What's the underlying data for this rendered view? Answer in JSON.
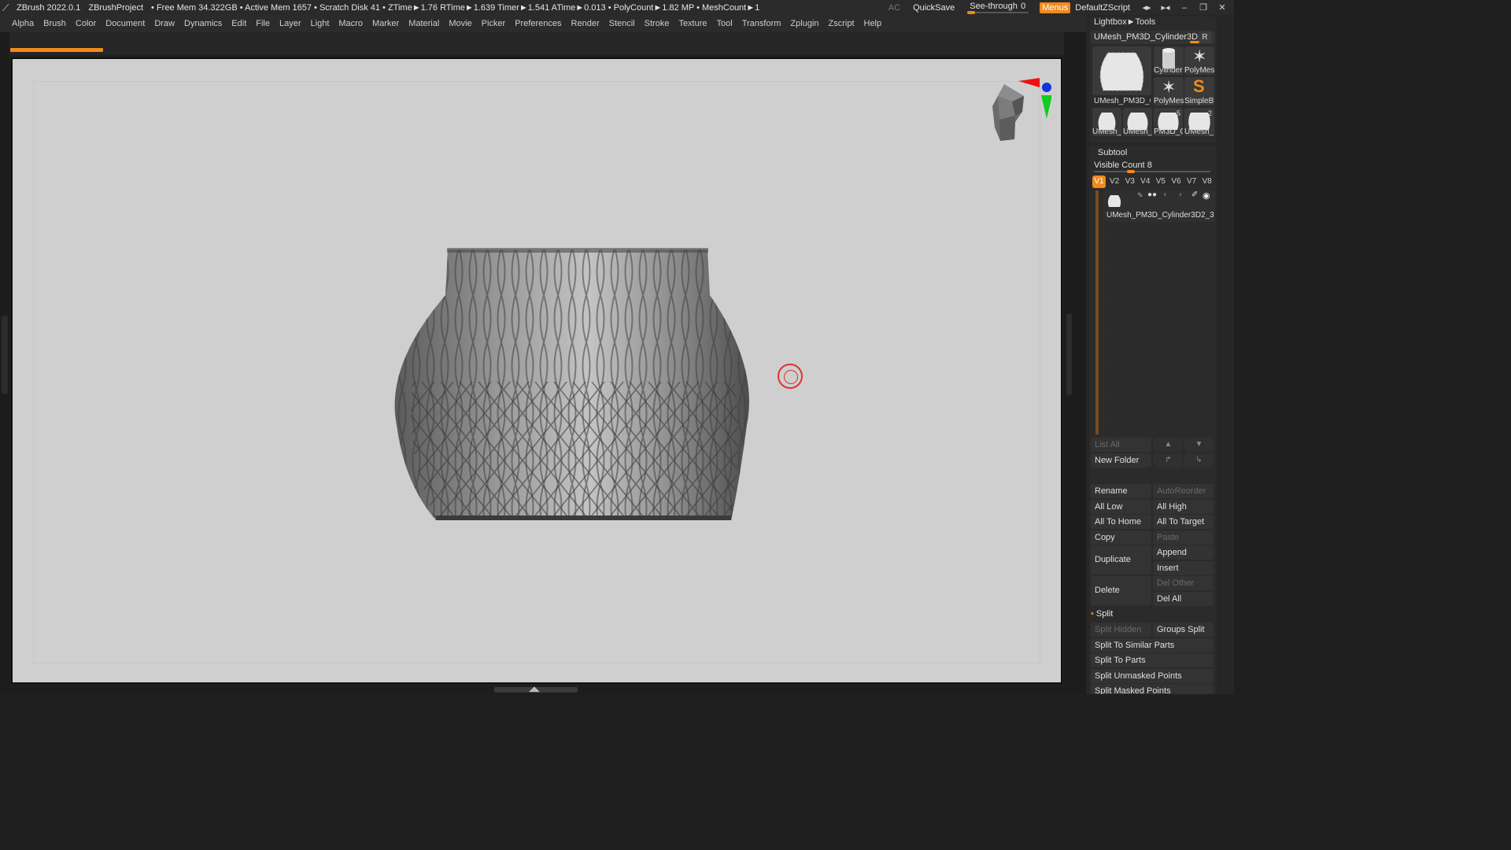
{
  "titlebar": {
    "app": "ZBrush 2022.0.1",
    "project": "ZBrushProject",
    "stats": "• Free Mem 34.322GB • Active Mem 1657 • Scratch Disk 41 • ZTime►1.76 RTime►1.639 Timer►1.541 ATime►0.013 • PolyCount►1.82 MP • MeshCount►1",
    "ac": "AC",
    "quicksave": "QuickSave",
    "see_through_label": "See-through",
    "see_through_value": "0",
    "menus": "Menus",
    "default_zscript": "DefaultZScript",
    "accent": "#f08a1c"
  },
  "menu": [
    "Alpha",
    "Brush",
    "Color",
    "Document",
    "Draw",
    "Dynamics",
    "Edit",
    "File",
    "Layer",
    "Light",
    "Macro",
    "Marker",
    "Material",
    "Movie",
    "Picker",
    "Preferences",
    "Render",
    "Stencil",
    "Stroke",
    "Texture",
    "Tool",
    "Transform",
    "Zplugin",
    "Zscript",
    "Help"
  ],
  "tool_palette": {
    "breadcrumb": "Lightbox►Tools",
    "current_tool": "UMesh_PM3D_Cylinder3D2_3",
    "r_button": "R",
    "thumbs": [
      {
        "label": "UMesh_PM3D_C",
        "icon": "vase-thumbnail-icon"
      },
      {
        "label": "Cylinder",
        "icon": "cylinder-icon"
      },
      {
        "label": "PolyMes",
        "icon": "polymesh-star-icon"
      },
      {
        "label": "PolyMes",
        "icon": "polymesh-star-icon"
      },
      {
        "label": "SimpleB",
        "icon": "simplebrush-icon"
      },
      {
        "label": "UMesh_",
        "icon": "vase-thumbnail-icon"
      },
      {
        "label": "UMesh_",
        "icon": "vase-thumbnail-icon"
      },
      {
        "label": "PM3D_C",
        "icon": "vase-thumbnail-icon",
        "num": "5"
      },
      {
        "label": "UMesh_",
        "icon": "vase-thumbnail-icon",
        "num": "2"
      }
    ]
  },
  "subtool": {
    "title": "Subtool",
    "visible_count_label": "Visible Count",
    "visible_count": "8",
    "versions": [
      "V1",
      "V2",
      "V3",
      "V4",
      "V5",
      "V6",
      "V7",
      "V8"
    ],
    "active_version": "V1",
    "items": [
      {
        "name": "UMesh_PM3D_Cylinder3D2_3"
      }
    ],
    "list_all": "List All",
    "new_folder": "New Folder",
    "buttons": {
      "rename": "Rename",
      "auto_reorder": "AutoReorder",
      "all_low": "All Low",
      "all_high": "All High",
      "all_to_home": "All To Home",
      "all_to_target": "All To Target",
      "copy": "Copy",
      "paste": "Paste",
      "duplicate": "Duplicate",
      "append": "Append",
      "insert": "Insert",
      "delete": "Delete",
      "del_other": "Del Other",
      "del_all": "Del All"
    }
  },
  "split": {
    "title": "Split",
    "buttons": {
      "split_hidden": "Split Hidden",
      "groups_split": "Groups Split",
      "split_to_similar_parts": "Split To Similar Parts",
      "split_to_parts": "Split To Parts",
      "split_unmasked_points": "Split Unmasked Points",
      "split_masked_points": "Split Masked Points"
    }
  },
  "colors": {
    "canvas_bg": "#cfcfcf",
    "ui_bg": "#262626",
    "accent": "#f08a1c"
  }
}
